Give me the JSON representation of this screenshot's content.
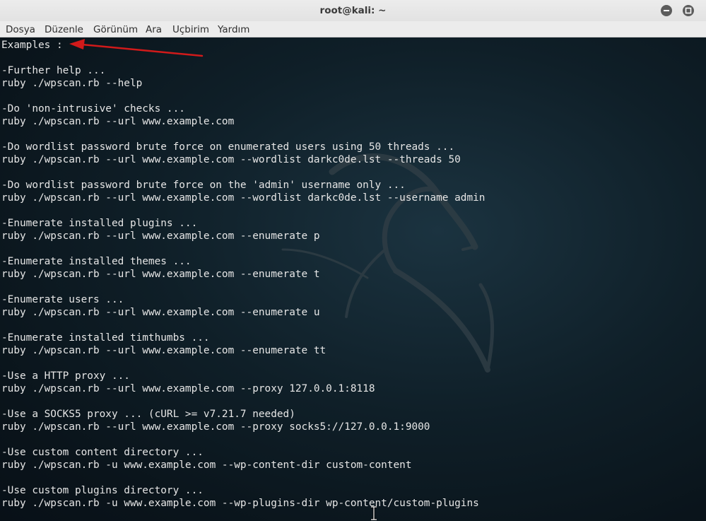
{
  "window": {
    "title": "root@kali: ~"
  },
  "menu": {
    "items": [
      "Dosya",
      "Düzenle",
      "Görünüm",
      "Ara",
      "Uçbirim",
      "Yardım"
    ]
  },
  "terminal": {
    "lines": [
      "Examples :",
      "",
      "-Further help ...",
      "ruby ./wpscan.rb --help",
      "",
      "-Do 'non-intrusive' checks ...",
      "ruby ./wpscan.rb --url www.example.com",
      "",
      "-Do wordlist password brute force on enumerated users using 50 threads ...",
      "ruby ./wpscan.rb --url www.example.com --wordlist darkc0de.lst --threads 50",
      "",
      "-Do wordlist password brute force on the 'admin' username only ...",
      "ruby ./wpscan.rb --url www.example.com --wordlist darkc0de.lst --username admin",
      "",
      "-Enumerate installed plugins ...",
      "ruby ./wpscan.rb --url www.example.com --enumerate p",
      "",
      "-Enumerate installed themes ...",
      "ruby ./wpscan.rb --url www.example.com --enumerate t",
      "",
      "-Enumerate users ...",
      "ruby ./wpscan.rb --url www.example.com --enumerate u",
      "",
      "-Enumerate installed timthumbs ...",
      "ruby ./wpscan.rb --url www.example.com --enumerate tt",
      "",
      "-Use a HTTP proxy ...",
      "ruby ./wpscan.rb --url www.example.com --proxy 127.0.0.1:8118",
      "",
      "-Use a SOCKS5 proxy ... (cURL >= v7.21.7 needed)",
      "ruby ./wpscan.rb --url www.example.com --proxy socks5://127.0.0.1:9000",
      "",
      "-Use custom content directory ...",
      "ruby ./wpscan.rb -u www.example.com --wp-content-dir custom-content",
      "",
      "-Use custom plugins directory ...",
      "ruby ./wpscan.rb -u www.example.com --wp-plugins-dir wp-content/custom-plugins"
    ]
  },
  "icons": {
    "minimize": "minimize-icon",
    "maximize": "maximize-icon",
    "annotation": "red-arrow-icon",
    "cursor": "text-cursor-icon",
    "wallpaper": "kali-dragon-icon"
  },
  "colors": {
    "terminal_text": "#e6e6e6",
    "terminal_bg": "#0f1f28",
    "arrow": "#d11a1a",
    "titlebar": "#e6e6e6"
  }
}
